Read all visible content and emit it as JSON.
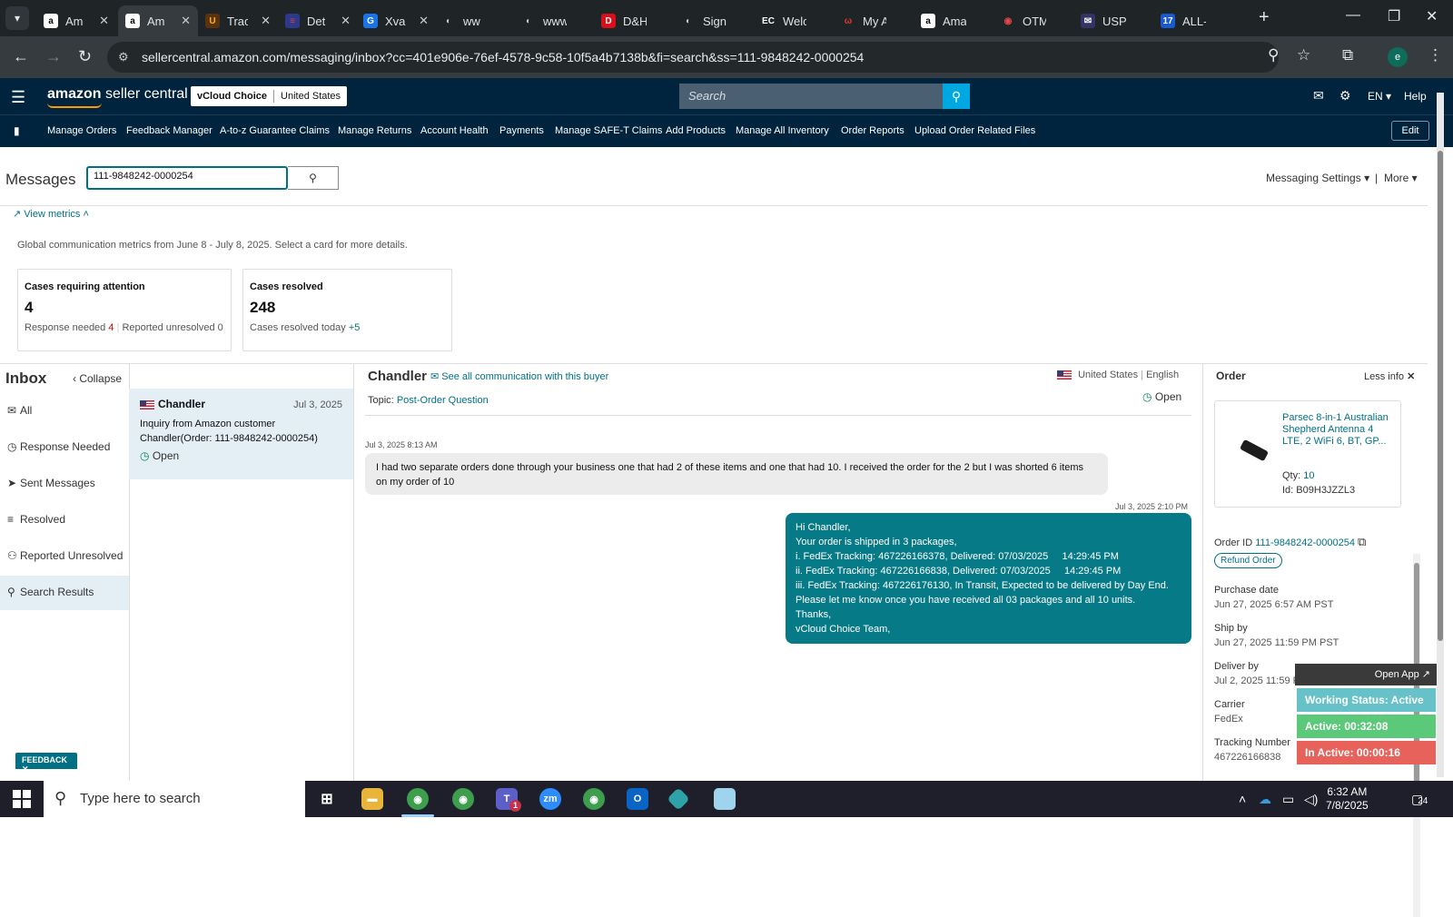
{
  "browser": {
    "tabs": [
      {
        "label": "Am",
        "fav": "a",
        "fav_bg": "#ffffff",
        "fav_fg": "#000000"
      },
      {
        "label": "Am",
        "fav": "a",
        "fav_bg": "#ffffff",
        "fav_fg": "#000000"
      },
      {
        "label": "Trac",
        "fav": "U",
        "fav_bg": "#5a3212",
        "fav_fg": "#ffb500"
      },
      {
        "label": "Det",
        "fav": "≡",
        "fav_bg": "#2d3a8c",
        "fav_fg": "#e0403a"
      },
      {
        "label": "Xva",
        "fav": "G",
        "fav_bg": "#1a73e8",
        "fav_fg": "#ffffff"
      },
      {
        "label": "ww",
        "fav": "◐",
        "fav_bg": "#1f2427",
        "fav_fg": "#c9cdd0"
      },
      {
        "label": "www.da",
        "fav": "◐",
        "fav_bg": "#1f2427",
        "fav_fg": "#c9cdd0"
      },
      {
        "label": "D&H Di",
        "fav": "D",
        "fav_bg": "#d8101c",
        "fav_fg": "#ffffff"
      },
      {
        "label": "Sign up",
        "fav": "◐",
        "fav_bg": "#1f2427",
        "fav_fg": "#c9cdd0"
      },
      {
        "label": "Welcom",
        "fav": "EC",
        "fav_bg": "#1f2427",
        "fav_fg": "#ffffff"
      },
      {
        "label": "My Acco",
        "fav": "ω",
        "fav_bg": "#1f2427",
        "fav_fg": "#e23a2d"
      },
      {
        "label": "Amazon",
        "fav": "a",
        "fav_bg": "#ffffff",
        "fav_fg": "#000000"
      },
      {
        "label": "OTMS",
        "fav": "◉",
        "fav_bg": "#1f2427",
        "fav_fg": "#e9474d"
      },
      {
        "label": "USPS.co",
        "fav": "✉",
        "fav_bg": "#333366",
        "fav_fg": "#ffffff"
      },
      {
        "label": "ALL-IN-",
        "fav": "17",
        "fav_bg": "#1a5ad1",
        "fav_fg": "#ffffff"
      }
    ],
    "url": "sellercentral.amazon.com/messaging/inbox?cc=401e906e-76ef-4578-9c58-10f5a4b7138b&fi=search&ss=111-9848242-0000254",
    "profile_initial": "e"
  },
  "header": {
    "logo_bold": "amazon",
    "logo_rest": " seller central",
    "store_name": "vCloud Choice",
    "store_region": "United States",
    "search_placeholder": "Search",
    "lang": "EN",
    "help": "Help"
  },
  "nav_links": [
    "Manage Orders",
    "Feedback Manager",
    "A-to-z Guarantee Claims",
    "Manage Returns",
    "Account Health",
    "Payments",
    "Manage SAFE-T Claims",
    "Add Products",
    "Manage All Inventory",
    "Order Reports",
    "Upload Order Related Files"
  ],
  "nav_edit": "Edit",
  "messages": {
    "title": "Messages",
    "search_value": "111-9848242-0000254",
    "settings": "Messaging Settings",
    "more": "More",
    "view_metrics": "View metrics",
    "metrics_desc": "Global communication metrics from June 8 - July 8, 2025. Select a card for more details."
  },
  "cards": [
    {
      "title": "Cases requiring attention",
      "value": "4",
      "sub1_label": "Response needed",
      "sub1_value": "4",
      "sub2_label": "Reported unresolved",
      "sub2_value": "0"
    },
    {
      "title": "Cases resolved",
      "value": "248",
      "sub1_label": "Cases resolved today",
      "sub1_value": "+5"
    }
  ],
  "inbox": {
    "title": "Inbox",
    "collapse": "Collapse",
    "items": [
      {
        "label": "All",
        "icon": "✉"
      },
      {
        "label": "Response Needed",
        "icon": "◷"
      },
      {
        "label": "Sent Messages",
        "icon": "➤"
      },
      {
        "label": "Resolved",
        "icon": "≡"
      },
      {
        "label": "Reported Unresolved",
        "icon": "⚇"
      },
      {
        "label": "Search Results",
        "icon": "⚲"
      }
    ]
  },
  "thread": {
    "name": "Chandler",
    "date": "Jul 3, 2025",
    "body": "Inquiry from Amazon customer Chandler(Order: 111-9848242-0000254)",
    "status": "Open"
  },
  "conversation": {
    "buyer": "Chandler",
    "see_all": "See all communication with this buyer",
    "country": "United States",
    "language": "English",
    "topic_label": "Topic:",
    "topic": "Post-Order Question",
    "status": "Open",
    "in_time": "Jul 3, 2025 8:13 AM",
    "in_text": "I had two separate orders done through your business one that had 2 of these items and one that had 10. I received the order for the 2 but I was shorted 6 items on my order of 10",
    "out_time": "Jul 3, 2025 2:10 PM",
    "out_lines": [
      "Hi Chandler,",
      "Your order is shipped in 3 packages,",
      "i. FedEx Tracking: 467226166378, Delivered: 07/03/2025     14:29:45 PM",
      "ii. FedEx Tracking: 467226166838, Delivered: 07/03/2025     14:29:45 PM",
      "iii. FedEx Tracking: 467226176130, In Transit, Expected to be delivered by Day End.",
      "Please let me know once you have received all 03 packages and all 10 units.",
      "Thanks,",
      "vCloud Choice Team,"
    ]
  },
  "order": {
    "title": "Order",
    "less_info": "Less info",
    "product_title": "Parsec 8-in-1 Australian Shepherd Antenna 4 LTE, 2 WiFi 6, BT, GP...",
    "qty_label": "Qty:",
    "qty": "10",
    "id_label": "Id:",
    "id": "B09H3JZZL3",
    "order_id_label": "Order ID",
    "order_id": "111-9848242-0000254",
    "refund": "Refund Order",
    "fields": [
      {
        "label": "Purchase date",
        "value": "Jun 27, 2025 6:57 AM PST"
      },
      {
        "label": "Ship by",
        "value": "Jun 27, 2025 11:59 PM PST"
      },
      {
        "label": "Deliver by",
        "value": "Jul 2, 2025 11:59 PM PST"
      },
      {
        "label": "Carrier",
        "value": "FedEx"
      },
      {
        "label": "Tracking Number",
        "value": "467226166838"
      }
    ]
  },
  "widget": {
    "open_app": "Open App ↗",
    "working_status": "Working Status: Active",
    "active": "Active: 00:32:08",
    "inactive": "In Active: 00:00:16"
  },
  "feedback": "FEEDBACK ✕",
  "taskbar": {
    "search_placeholder": "Type here to search",
    "time": "6:32 AM",
    "date": "7/8/2025",
    "notif_count": "24",
    "teams_badge": "1"
  },
  "colors": {
    "header_bg": "#00243d",
    "accent_link": "#007185",
    "reply_bubble": "#077a87",
    "status_green": "#5cc97a",
    "status_red": "#e8625c",
    "status_teal": "#66c2c8"
  }
}
